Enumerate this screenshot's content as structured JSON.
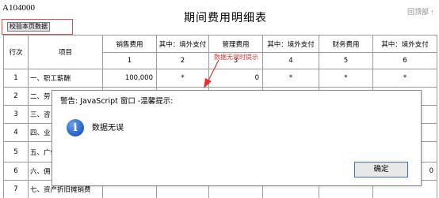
{
  "header": {
    "form_code": "A104000",
    "back_to_top": "回顶部 ↑",
    "title": "期间费用明细表"
  },
  "toolbar": {
    "check_label": "校验本页数据"
  },
  "table": {
    "columns": [
      "行次",
      "项目",
      "销售费用",
      "其中：境外支付",
      "管理费用",
      "其中：境外支付",
      "财务费用",
      "其中：境外支付"
    ],
    "column_numbers": [
      "1",
      "2",
      "3",
      "4",
      "5",
      "6"
    ],
    "rows": [
      {
        "no": "1",
        "item": "一、职工薪酬",
        "sales": "100,000",
        "sales_foreign": "*",
        "admin": "0",
        "admin_foreign": "*",
        "finance": "*",
        "finance_foreign": "*"
      },
      {
        "no": "2",
        "item": "二、劳"
      },
      {
        "no": "3",
        "item": "三、咨"
      },
      {
        "no": "4",
        "item": "四、业"
      },
      {
        "no": "5",
        "item": "五、广传费"
      },
      {
        "no": "6",
        "item": "六、佣",
        "trail": "0"
      },
      {
        "no": "7",
        "item": "七、资产折旧摊销费"
      }
    ]
  },
  "hint": "数据无误时提示",
  "dialog": {
    "title": "警告: JavaScript 窗口 -温馨提示:",
    "icon": "info-icon",
    "message": "数据无误",
    "ok_label": "确定"
  },
  "colors": {
    "hint_red": "#e03030",
    "dialog_border": "#8a8a8a",
    "button_border": "#3470c8",
    "icon_blue": "#1f5fc6"
  }
}
